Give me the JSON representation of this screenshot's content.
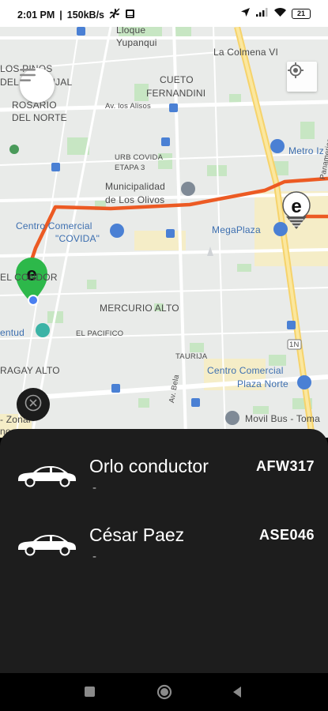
{
  "status_bar": {
    "time": "2:01 PM",
    "network_speed": "150kB/s",
    "battery": "21"
  },
  "map": {
    "labels": {
      "lloque": "Lloque",
      "yupanqui": "Yupanqui",
      "colmena": "La Colmena VI",
      "los_pinos": "LOS PINOS",
      "del_naranjal": "DEL NARANJAL",
      "cueto": "CUETO",
      "fernandini": "FERNANDINI",
      "rosario": "ROSARIO",
      "del_norte": "DEL NORTE",
      "av_los_alisos": "Av. los Alisos",
      "metro": "Metro Iz",
      "urb_covida": "URB COVIDA",
      "etapa": "ETAPA 3",
      "municipalidad": "Municipalidad",
      "de_los_olivos": "de Los Olivos",
      "cc_covida_1": "Centro Comercial",
      "cc_covida_2": "\"COVIDA\"",
      "megaplaza": "MegaPlaza",
      "el_condor": "EL CONDOR",
      "mercurio": "MERCURIO ALTO",
      "el_pacifico": "EL PACIFICO",
      "entud": "entud",
      "taurija": "TAURIJA",
      "naragay": "RAGAY ALTO",
      "plaza_norte_1": "Centro Comercial",
      "plaza_norte_2": "Plaza Norte",
      "movil_bus": "Movil Bus - Toma",
      "zonal": "- Zonal",
      "shoes": "noes",
      "av_belaunde": "Av. Bela",
      "route_1n": "1N",
      "panamericana": "Panamerican"
    }
  },
  "drivers": [
    {
      "name": "Orlo conductor",
      "subtitle": "-",
      "plate": "AFW317"
    },
    {
      "name": "César Paez",
      "subtitle": "-",
      "plate": "ASE046"
    }
  ],
  "colors": {
    "route": "#ec5a23",
    "marker_green": "#2db84a",
    "sheet_bg": "#1d1d1d",
    "accent_blue": "#1a73e8"
  }
}
